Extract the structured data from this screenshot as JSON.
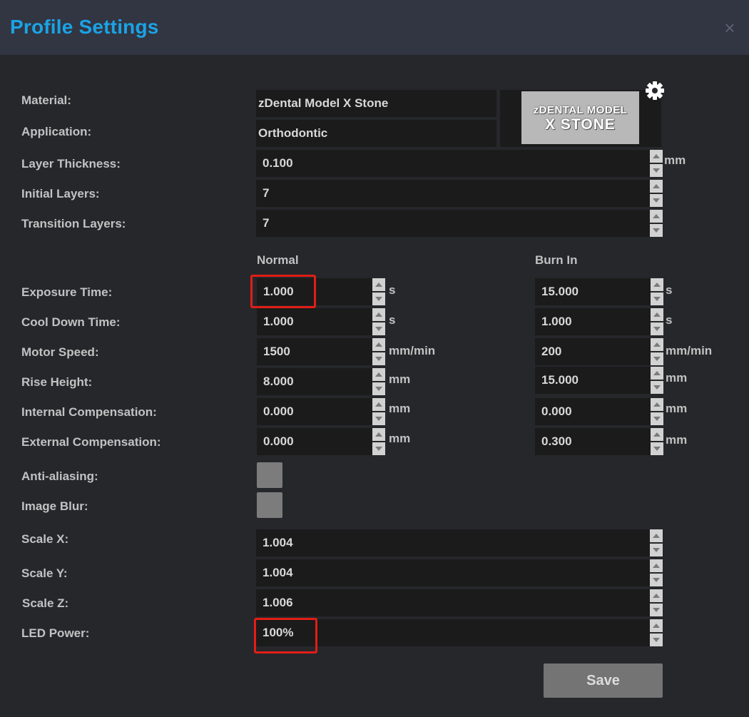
{
  "window": {
    "title": "Profile Settings",
    "close_icon": "close-icon"
  },
  "material": {
    "label": "Material:",
    "value": "zDental Model X Stone"
  },
  "application": {
    "label": "Application:",
    "value": "Orthodontic"
  },
  "logo": {
    "line1": "zDENTAL MODEL",
    "line2": "X STONE",
    "settings_icon": "gear-icon"
  },
  "layer_thickness": {
    "label": "Layer Thickness:",
    "value": "0.100",
    "unit": "mm"
  },
  "initial_layers": {
    "label": "Initial Layers:",
    "value": "7"
  },
  "transition_layers": {
    "label": "Transition Layers:",
    "value": "7"
  },
  "columns": {
    "normal": "Normal",
    "burn_in": "Burn In"
  },
  "exposure_time": {
    "label": "Exposure Time:",
    "normal": "1.000",
    "burn_in": "15.000",
    "unit": "s"
  },
  "cool_down_time": {
    "label": "Cool Down Time:",
    "normal": "1.000",
    "burn_in": "1.000",
    "unit": "s"
  },
  "motor_speed": {
    "label": "Motor Speed:",
    "normal": "1500",
    "burn_in": "200",
    "unit": "mm/min"
  },
  "rise_height": {
    "label": "Rise Height:",
    "normal": "8.000",
    "burn_in": "15.000",
    "unit": "mm"
  },
  "internal_compensation": {
    "label": "Internal Compensation:",
    "normal": "0.000",
    "burn_in": "0.000",
    "unit": "mm"
  },
  "external_compensation": {
    "label": "External Compensation:",
    "normal": "0.000",
    "burn_in": "0.300",
    "unit": "mm"
  },
  "anti_aliasing": {
    "label": "Anti-aliasing:",
    "checked": false
  },
  "image_blur": {
    "label": "Image Blur:",
    "checked": false
  },
  "scale_x": {
    "label": "Scale X:",
    "value": "1.004"
  },
  "scale_y": {
    "label": "Scale Y:",
    "value": "1.004"
  },
  "scale_z": {
    "label": "Scale Z:",
    "value": "1.006"
  },
  "led_power": {
    "label": "LED Power:",
    "value": "100%"
  },
  "save_label": "Save",
  "colors": {
    "title": "#1aa3e6",
    "highlight": "#e21d16",
    "titlebar": "#323542",
    "background": "#26272b"
  }
}
